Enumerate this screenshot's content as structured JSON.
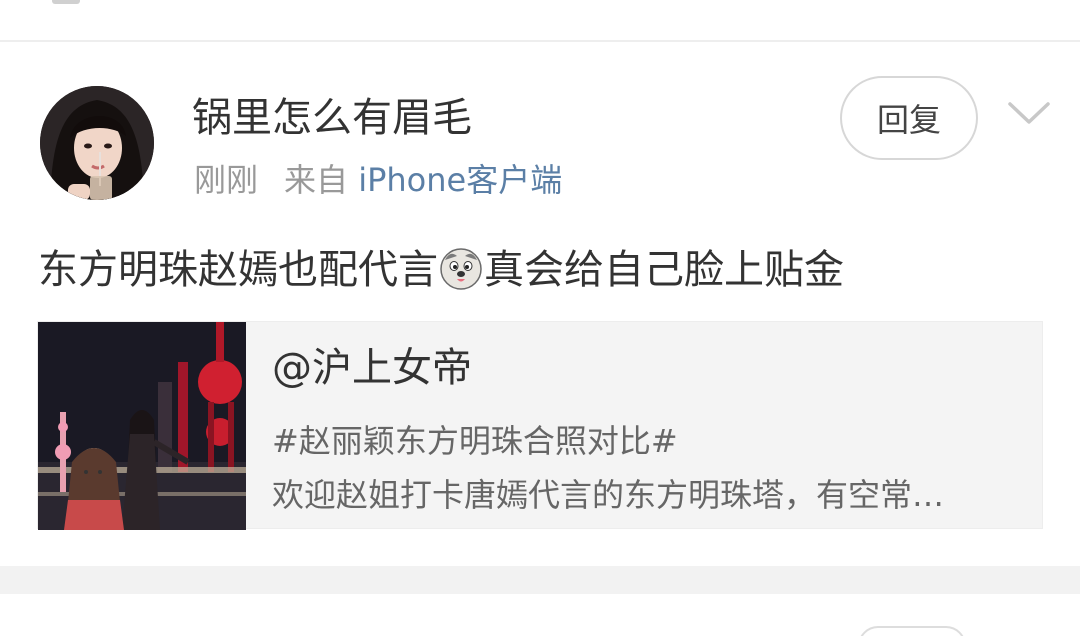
{
  "comment": {
    "username": "锅里怎么有眉毛",
    "time": "刚刚",
    "source_prefix": "来自",
    "device": "iPhone客户端",
    "reply_label": "回复",
    "text_before_emoji": "东方明珠赵嫣也配代言",
    "emoji_icon": "doge-emoji-icon",
    "text_after_emoji": "真会给自己脸上贴金"
  },
  "quoted_card": {
    "title": "@沪上女帝",
    "hashtag": "#赵丽颖东方明珠合照对比#",
    "description": "欢迎赵姐打卡唐嫣代言的东方明珠塔，有空常…"
  },
  "icons": {
    "chevron": "chevron-down-icon",
    "avatar": "avatar"
  },
  "colors": {
    "link_blue": "#5b7fa6",
    "meta_gray": "#999999",
    "card_bg": "#f4f4f4",
    "divider": "#eeeeee"
  }
}
